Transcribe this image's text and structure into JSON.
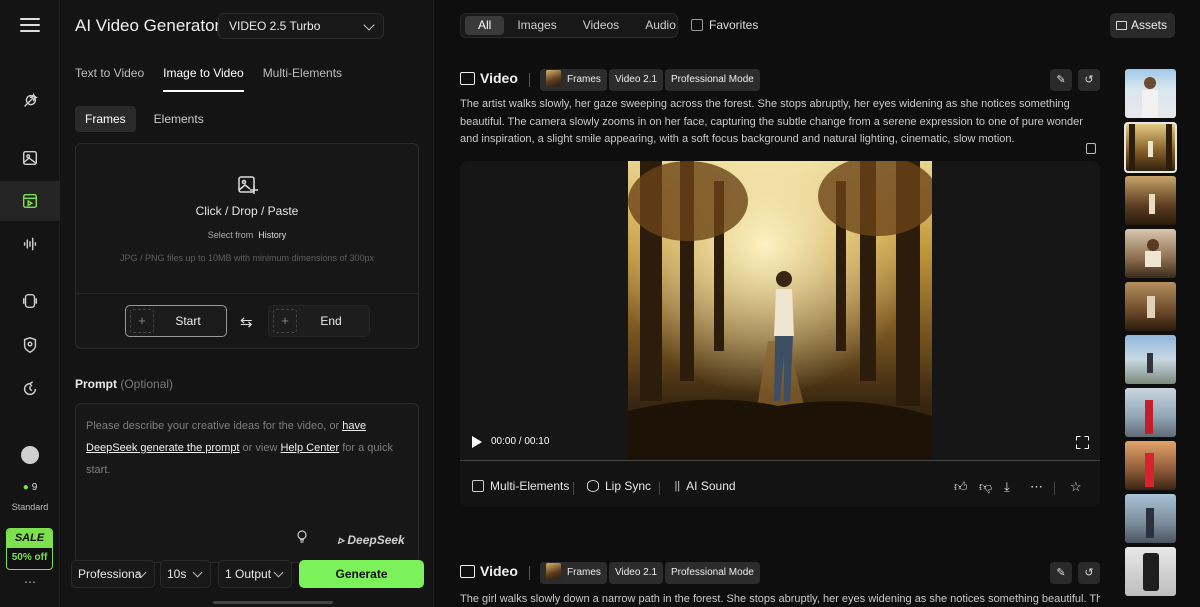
{
  "app": {
    "title": "AI Video Generator",
    "model": "VIDEO 2.5 Turbo"
  },
  "rail": {
    "icons": [
      "menu-icon",
      "sparkle-tool-icon",
      "image-icon",
      "video-icon",
      "audio-wave-icon",
      "avatar-tool-icon",
      "shield-icon",
      "refresh-icon"
    ],
    "credits": "9",
    "tier": "Standard",
    "sale": {
      "label": "SALE",
      "discount": "50% off"
    },
    "more": "⋯"
  },
  "panel": {
    "mode_tabs": [
      "Text to Video",
      "Image to Video",
      "Multi-Elements"
    ],
    "active_mode": "Image to Video",
    "sub_tabs": [
      "Frames",
      "Elements"
    ],
    "upload": {
      "title": "Click / Drop / Paste",
      "select_from": "Select from",
      "history": "History",
      "hint": "JPG / PNG files up to 10MB with minimum dimensions of 300px",
      "start": "Start",
      "end": "End"
    },
    "prompt": {
      "label": "Prompt",
      "optional": "(Optional)",
      "placeholder_a": "Please describe your creative ideas for the video, or ",
      "link_a": "have DeepSeek generate the prompt",
      "placeholder_b": " or view ",
      "link_b": "Help Center",
      "placeholder_c": " for a quick start.",
      "brand": "DeepSeek"
    },
    "bottom": {
      "mode": "Professiona",
      "duration": "10s",
      "outputs": "1 Output",
      "generate": "Generate"
    }
  },
  "filters": {
    "items": [
      "All",
      "Images",
      "Videos",
      "Audio"
    ],
    "active": "All",
    "favorites": "Favorites",
    "assets": "Assets"
  },
  "cards": [
    {
      "type": "Video",
      "tags": [
        "Frames",
        "Video 2.1",
        "Professional Mode"
      ],
      "description": "The artist walks slowly, her gaze sweeping across the forest. She stops abruptly, her eyes widening as she notices something beautiful. The camera slowly zooms in on her face, capturing the subtle change from a serene expression to one of pure wonder and inspiration, a slight smile appearing, with a soft focus background and natural lighting, cinematic, slow motion.",
      "time": "00:00 / 00:10",
      "actions": [
        "Multi-Elements",
        "Lip Sync",
        "AI Sound"
      ]
    },
    {
      "type": "Video",
      "tags": [
        "Frames",
        "Video 2.1",
        "Professional Mode"
      ],
      "description": "The girl walks slowly down a narrow path in the forest. She stops abruptly, her eyes widening as she notices something beautiful. The"
    }
  ],
  "colors": {
    "accent": "#7cf25a",
    "bg": "#0e0e0e",
    "panel": "#141414"
  }
}
